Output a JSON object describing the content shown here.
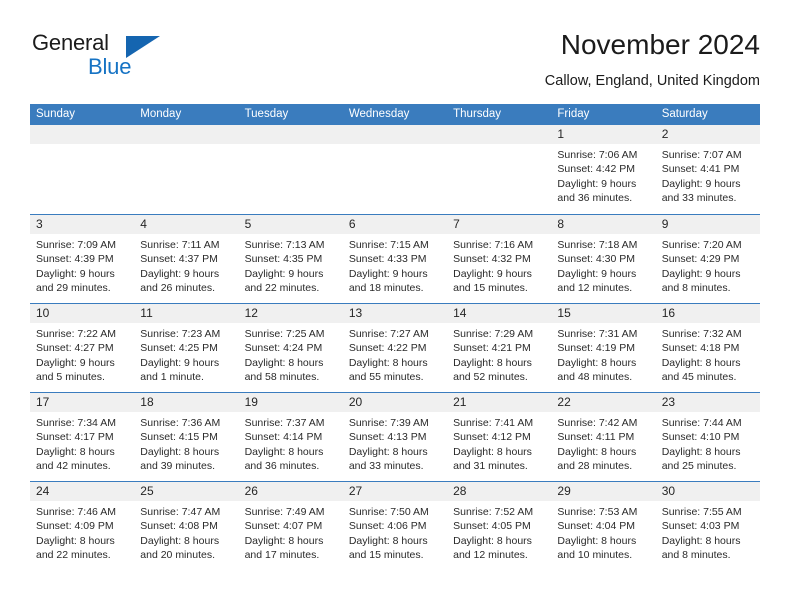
{
  "brand": {
    "name_top": "General",
    "name_bottom": "Blue",
    "triangle_icon": "brand-triangle-icon",
    "color_blue": "#1673c4",
    "color_dark": "#1b1b1b"
  },
  "header": {
    "title": "November 2024",
    "subtitle": "Callow, England, United Kingdom"
  },
  "theme": {
    "header_bg": "#3a7cbe",
    "header_text": "#ffffff",
    "daynum_band_bg": "#f0f0f0",
    "cell_bg": "#ffffff",
    "row_border": "#3a7cbe",
    "body_text": "#2a2a2a"
  },
  "weekdays": [
    "Sunday",
    "Monday",
    "Tuesday",
    "Wednesday",
    "Thursday",
    "Friday",
    "Saturday"
  ],
  "weeks": [
    [
      {
        "day": "",
        "lines": []
      },
      {
        "day": "",
        "lines": []
      },
      {
        "day": "",
        "lines": []
      },
      {
        "day": "",
        "lines": []
      },
      {
        "day": "",
        "lines": []
      },
      {
        "day": "1",
        "lines": [
          "Sunrise: 7:06 AM",
          "Sunset: 4:42 PM",
          "Daylight: 9 hours",
          "and 36 minutes."
        ]
      },
      {
        "day": "2",
        "lines": [
          "Sunrise: 7:07 AM",
          "Sunset: 4:41 PM",
          "Daylight: 9 hours",
          "and 33 minutes."
        ]
      }
    ],
    [
      {
        "day": "3",
        "lines": [
          "Sunrise: 7:09 AM",
          "Sunset: 4:39 PM",
          "Daylight: 9 hours",
          "and 29 minutes."
        ]
      },
      {
        "day": "4",
        "lines": [
          "Sunrise: 7:11 AM",
          "Sunset: 4:37 PM",
          "Daylight: 9 hours",
          "and 26 minutes."
        ]
      },
      {
        "day": "5",
        "lines": [
          "Sunrise: 7:13 AM",
          "Sunset: 4:35 PM",
          "Daylight: 9 hours",
          "and 22 minutes."
        ]
      },
      {
        "day": "6",
        "lines": [
          "Sunrise: 7:15 AM",
          "Sunset: 4:33 PM",
          "Daylight: 9 hours",
          "and 18 minutes."
        ]
      },
      {
        "day": "7",
        "lines": [
          "Sunrise: 7:16 AM",
          "Sunset: 4:32 PM",
          "Daylight: 9 hours",
          "and 15 minutes."
        ]
      },
      {
        "day": "8",
        "lines": [
          "Sunrise: 7:18 AM",
          "Sunset: 4:30 PM",
          "Daylight: 9 hours",
          "and 12 minutes."
        ]
      },
      {
        "day": "9",
        "lines": [
          "Sunrise: 7:20 AM",
          "Sunset: 4:29 PM",
          "Daylight: 9 hours",
          "and 8 minutes."
        ]
      }
    ],
    [
      {
        "day": "10",
        "lines": [
          "Sunrise: 7:22 AM",
          "Sunset: 4:27 PM",
          "Daylight: 9 hours",
          "and 5 minutes."
        ]
      },
      {
        "day": "11",
        "lines": [
          "Sunrise: 7:23 AM",
          "Sunset: 4:25 PM",
          "Daylight: 9 hours",
          "and 1 minute."
        ]
      },
      {
        "day": "12",
        "lines": [
          "Sunrise: 7:25 AM",
          "Sunset: 4:24 PM",
          "Daylight: 8 hours",
          "and 58 minutes."
        ]
      },
      {
        "day": "13",
        "lines": [
          "Sunrise: 7:27 AM",
          "Sunset: 4:22 PM",
          "Daylight: 8 hours",
          "and 55 minutes."
        ]
      },
      {
        "day": "14",
        "lines": [
          "Sunrise: 7:29 AM",
          "Sunset: 4:21 PM",
          "Daylight: 8 hours",
          "and 52 minutes."
        ]
      },
      {
        "day": "15",
        "lines": [
          "Sunrise: 7:31 AM",
          "Sunset: 4:19 PM",
          "Daylight: 8 hours",
          "and 48 minutes."
        ]
      },
      {
        "day": "16",
        "lines": [
          "Sunrise: 7:32 AM",
          "Sunset: 4:18 PM",
          "Daylight: 8 hours",
          "and 45 minutes."
        ]
      }
    ],
    [
      {
        "day": "17",
        "lines": [
          "Sunrise: 7:34 AM",
          "Sunset: 4:17 PM",
          "Daylight: 8 hours",
          "and 42 minutes."
        ]
      },
      {
        "day": "18",
        "lines": [
          "Sunrise: 7:36 AM",
          "Sunset: 4:15 PM",
          "Daylight: 8 hours",
          "and 39 minutes."
        ]
      },
      {
        "day": "19",
        "lines": [
          "Sunrise: 7:37 AM",
          "Sunset: 4:14 PM",
          "Daylight: 8 hours",
          "and 36 minutes."
        ]
      },
      {
        "day": "20",
        "lines": [
          "Sunrise: 7:39 AM",
          "Sunset: 4:13 PM",
          "Daylight: 8 hours",
          "and 33 minutes."
        ]
      },
      {
        "day": "21",
        "lines": [
          "Sunrise: 7:41 AM",
          "Sunset: 4:12 PM",
          "Daylight: 8 hours",
          "and 31 minutes."
        ]
      },
      {
        "day": "22",
        "lines": [
          "Sunrise: 7:42 AM",
          "Sunset: 4:11 PM",
          "Daylight: 8 hours",
          "and 28 minutes."
        ]
      },
      {
        "day": "23",
        "lines": [
          "Sunrise: 7:44 AM",
          "Sunset: 4:10 PM",
          "Daylight: 8 hours",
          "and 25 minutes."
        ]
      }
    ],
    [
      {
        "day": "24",
        "lines": [
          "Sunrise: 7:46 AM",
          "Sunset: 4:09 PM",
          "Daylight: 8 hours",
          "and 22 minutes."
        ]
      },
      {
        "day": "25",
        "lines": [
          "Sunrise: 7:47 AM",
          "Sunset: 4:08 PM",
          "Daylight: 8 hours",
          "and 20 minutes."
        ]
      },
      {
        "day": "26",
        "lines": [
          "Sunrise: 7:49 AM",
          "Sunset: 4:07 PM",
          "Daylight: 8 hours",
          "and 17 minutes."
        ]
      },
      {
        "day": "27",
        "lines": [
          "Sunrise: 7:50 AM",
          "Sunset: 4:06 PM",
          "Daylight: 8 hours",
          "and 15 minutes."
        ]
      },
      {
        "day": "28",
        "lines": [
          "Sunrise: 7:52 AM",
          "Sunset: 4:05 PM",
          "Daylight: 8 hours",
          "and 12 minutes."
        ]
      },
      {
        "day": "29",
        "lines": [
          "Sunrise: 7:53 AM",
          "Sunset: 4:04 PM",
          "Daylight: 8 hours",
          "and 10 minutes."
        ]
      },
      {
        "day": "30",
        "lines": [
          "Sunrise: 7:55 AM",
          "Sunset: 4:03 PM",
          "Daylight: 8 hours",
          "and 8 minutes."
        ]
      }
    ]
  ]
}
